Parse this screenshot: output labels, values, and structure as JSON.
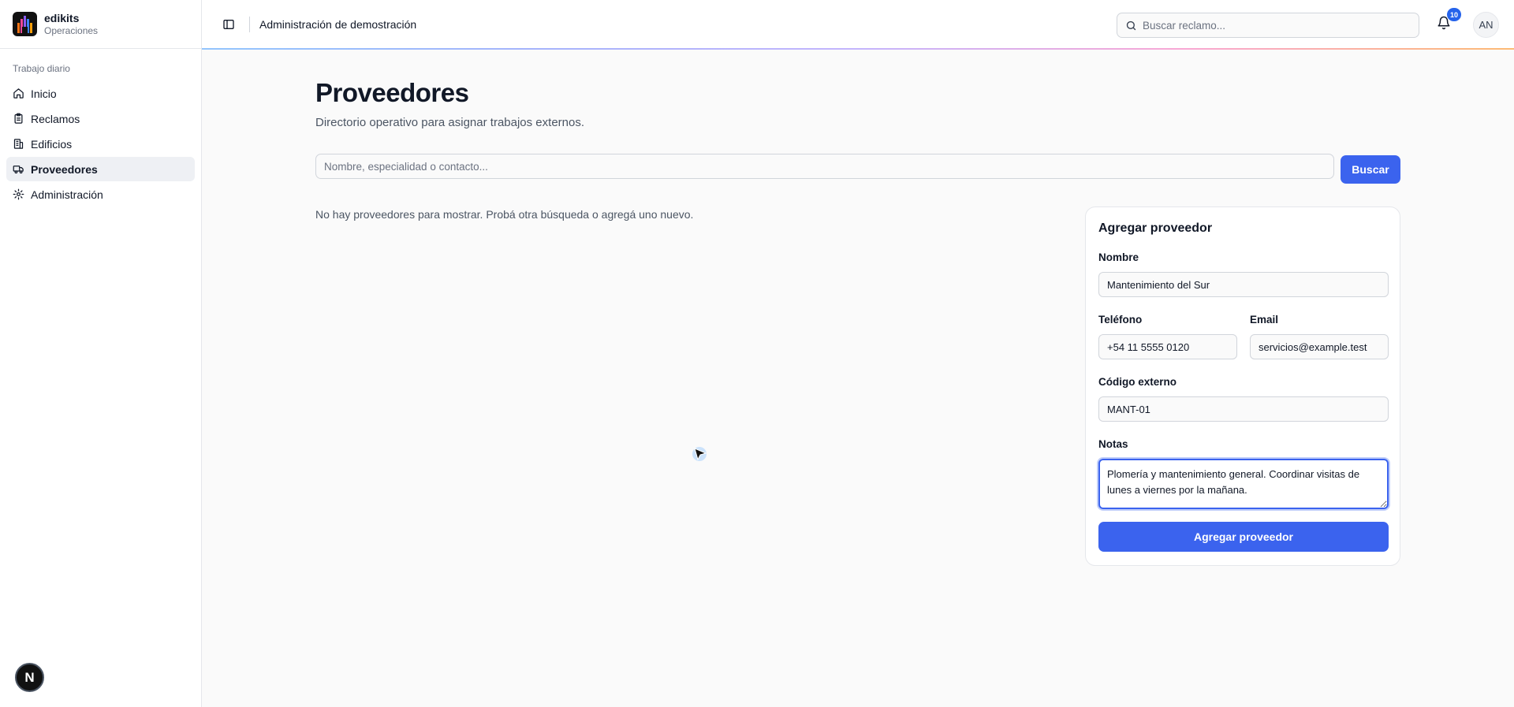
{
  "brand": {
    "name": "edikits",
    "subtitle": "Operaciones"
  },
  "sidebar": {
    "group_label": "Trabajo diario",
    "items": [
      {
        "label": "Inicio",
        "icon": "home-icon",
        "active": false
      },
      {
        "label": "Reclamos",
        "icon": "clipboard-icon",
        "active": false
      },
      {
        "label": "Edificios",
        "icon": "building-icon",
        "active": false
      },
      {
        "label": "Proveedores",
        "icon": "truck-icon",
        "active": true
      },
      {
        "label": "Administración",
        "icon": "gear-icon",
        "active": false
      }
    ],
    "bottom_avatar": "N"
  },
  "header": {
    "title": "Administración de demostración",
    "search_placeholder": "Buscar reclamo...",
    "notification_count": "10",
    "user_initials": "AN"
  },
  "page": {
    "title": "Proveedores",
    "subtitle": "Directorio operativo para asignar trabajos externos.",
    "filter_placeholder": "Nombre, especialidad o contacto...",
    "search_button": "Buscar",
    "empty_message": "No hay proveedores para mostrar. Probá otra búsqueda o agregá uno nuevo."
  },
  "form": {
    "title": "Agregar proveedor",
    "name_label": "Nombre",
    "name_value": "Mantenimiento del Sur",
    "phone_label": "Teléfono",
    "phone_value": "+54 11 5555 0120",
    "email_label": "Email",
    "email_value": "servicios@example.test",
    "code_label": "Código externo",
    "code_value": "MANT-01",
    "notes_label": "Notas",
    "notes_value": "Plomería y mantenimiento general. Coordinar visitas de lunes a viernes por la mañana.",
    "submit_label": "Agregar proveedor"
  },
  "colors": {
    "accent": "#3b63ee",
    "sidebar_active": "#eef0f4"
  }
}
